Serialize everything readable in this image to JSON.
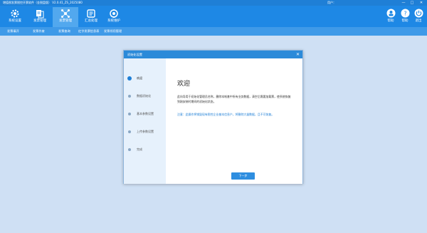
{
  "window": {
    "title": "增值税发票税控开票软件（金税盘版） V2.0.41_ZS_2025080",
    "user": "用户：",
    "minimize": "—",
    "maximize": "□",
    "close": "✕"
  },
  "ribbon": {
    "buttons": [
      {
        "label": "系统设置",
        "icon": "gear-icon"
      },
      {
        "label": "发票管理",
        "icon": "invoice-icon"
      },
      {
        "label": "发票管理",
        "icon": "network-icon"
      },
      {
        "label": "汇总处理",
        "icon": "summary-icon"
      },
      {
        "label": "系统维护",
        "icon": "maintenance-icon"
      }
    ],
    "right": [
      {
        "label": "帮助",
        "icon": "help-icon"
      },
      {
        "label": "帮助",
        "icon": "question-icon"
      },
      {
        "label": "退出",
        "icon": "power-icon"
      }
    ]
  },
  "subnav": [
    "发票填开",
    "发票作废",
    "发票查询",
    "红字发票信息表",
    "发票领用管理"
  ],
  "dialog": {
    "title": "初始化设置",
    "close": "✕",
    "steps": [
      "欢迎",
      "数据初始化",
      "基本参数设置",
      "上传参数设置",
      "完成"
    ],
    "heading": "欢迎",
    "text": "此向导用于初始化管理员名称，删除本帐套中所有业务数据，清空后需要加载票，使系统恢复到刚安装时期间的初始化状态。",
    "note": "注意：此操作将销毁现有税控企业基本信息户，将删除大量数据，且不可恢复。",
    "next_label": "下一步"
  },
  "colors": {
    "ribbon": "#1e88e5",
    "accent": "#1f7fd6",
    "background": "#cfe0f4"
  }
}
